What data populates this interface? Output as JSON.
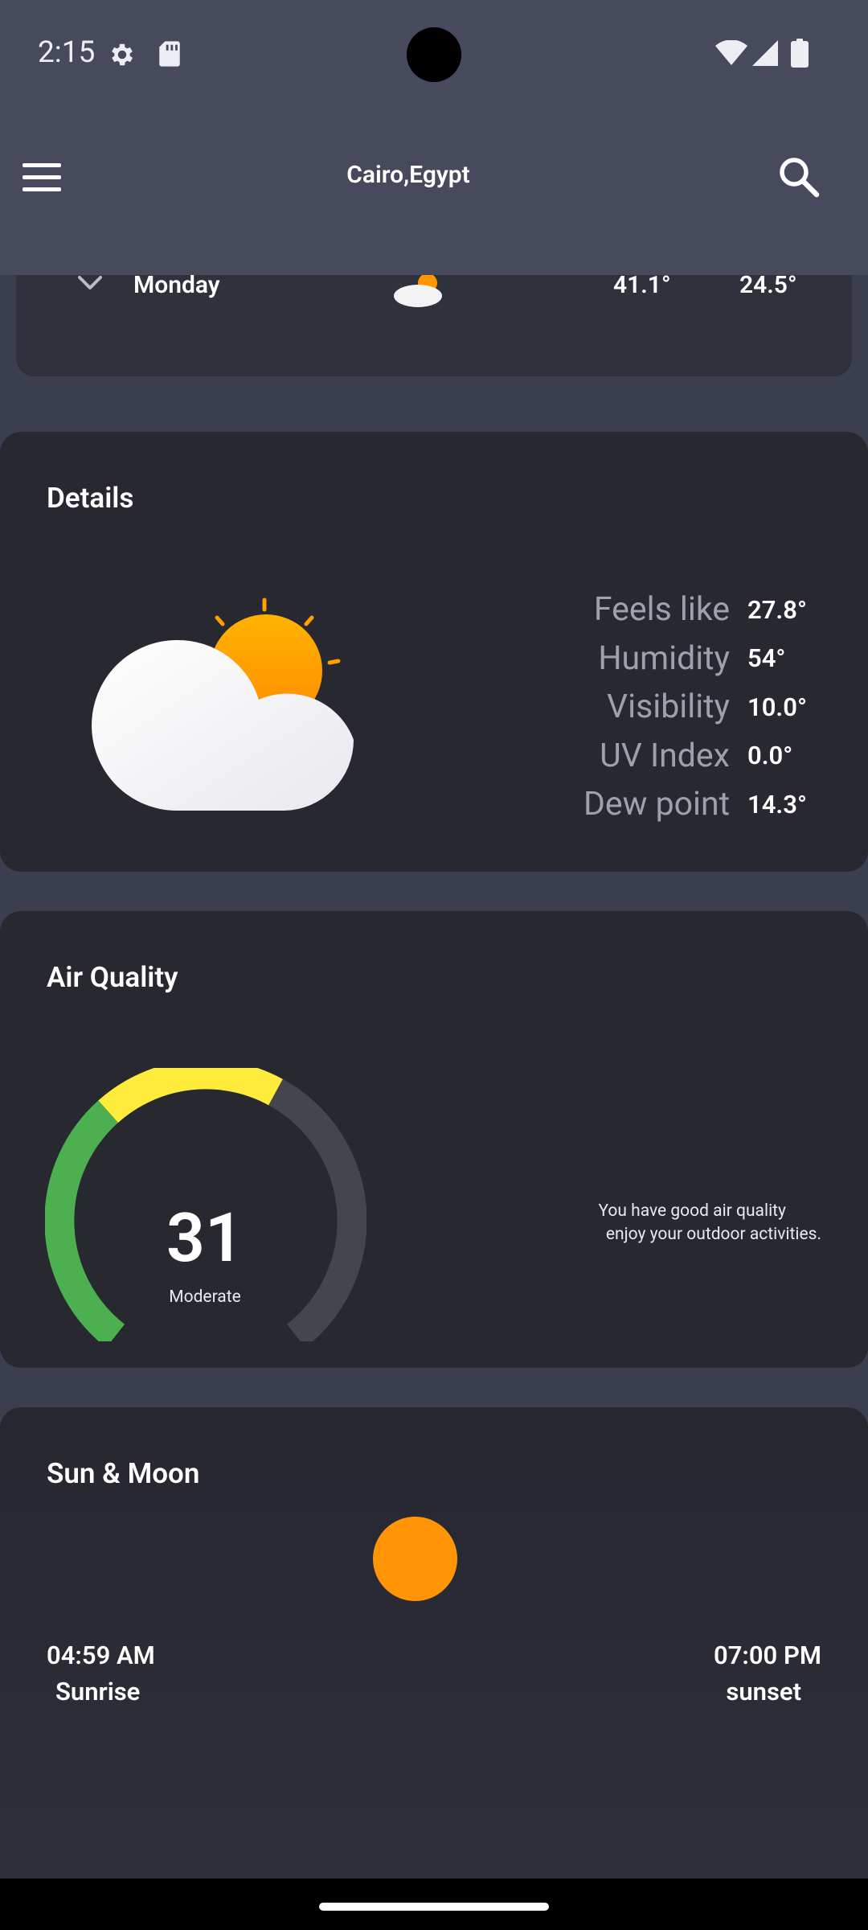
{
  "status_bar": {
    "time": "2:15",
    "icons": [
      "gear-icon",
      "sd-card-icon",
      "wifi-icon",
      "signal-icon",
      "battery-icon"
    ]
  },
  "app_bar": {
    "title": "Cairo,Egypt",
    "menu_icon": "hamburger-menu-icon",
    "search_icon": "search-icon"
  },
  "forecast_row": {
    "day": "Monday",
    "high": "41.1°",
    "low": "24.5°",
    "icon": "partly-cloudy-icon"
  },
  "details": {
    "title": "Details",
    "icon": "partly-cloudy-icon",
    "items": [
      {
        "label": "Feels like",
        "value": "27.8°"
      },
      {
        "label": "Humidity",
        "value": "54°"
      },
      {
        "label": "Visibility",
        "value": "10.0°"
      },
      {
        "label": "UV Index",
        "value": "0.0°"
      },
      {
        "label": "Dew point",
        "value": "14.3°"
      }
    ]
  },
  "air_quality": {
    "title": "Air Quality",
    "value": "31",
    "label": "Moderate",
    "message_line1": "You have good air quality",
    "message_line2": "enjoy your outdoor activities.",
    "colors": {
      "good": "#4caf50",
      "moderate": "#ffeb3b",
      "track": "#45464d"
    }
  },
  "sun_moon": {
    "title": "Sun & Moon",
    "sunrise_time": "04:59 AM",
    "sunrise_label": "Sunrise",
    "sunset_time": "07:00 PM",
    "sunset_label": "sunset",
    "sun_color": "#ff9505"
  }
}
